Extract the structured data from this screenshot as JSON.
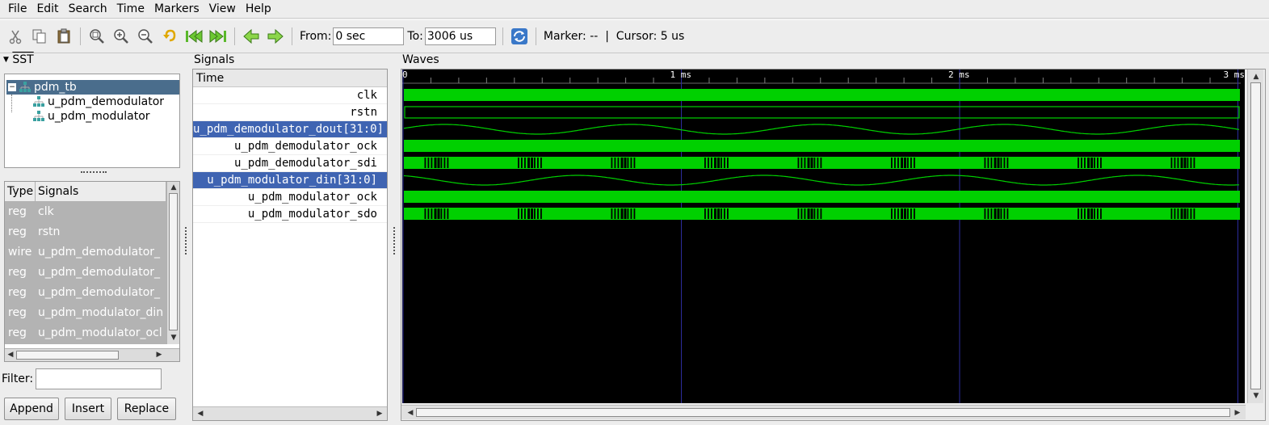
{
  "menu": [
    "File",
    "Edit",
    "Search",
    "Time",
    "Markers",
    "View",
    "Help"
  ],
  "toolbar": {
    "icons": [
      "cut-icon",
      "copy-icon",
      "paste-icon",
      "zoom-fit-icon",
      "zoom-in-icon",
      "zoom-out-icon",
      "undo-zoom-icon",
      "go-to-start-icon",
      "go-to-end-icon",
      "prev-edge-icon",
      "next-edge-icon"
    ],
    "from_label": "From:",
    "from_value": "0 sec",
    "to_label": "To:",
    "to_value": "3006 us",
    "reload_icon": "reload-icon",
    "marker_text": "Marker: --  |  Cursor: 5 us"
  },
  "sst": {
    "title": "SST",
    "tree": {
      "root": "pdm_tb",
      "children": [
        "u_pdm_demodulator",
        "u_pdm_modulator"
      ]
    },
    "list": {
      "col_type": "Type",
      "col_signals": "Signals",
      "rows": [
        {
          "type": "reg",
          "name": "clk"
        },
        {
          "type": "reg",
          "name": "rstn"
        },
        {
          "type": "wire",
          "name": "u_pdm_demodulator_"
        },
        {
          "type": "reg",
          "name": "u_pdm_demodulator_"
        },
        {
          "type": "reg",
          "name": "u_pdm_demodulator_"
        },
        {
          "type": "reg",
          "name": "u_pdm_modulator_din"
        },
        {
          "type": "reg",
          "name": "u_pdm_modulator_ocl"
        }
      ]
    },
    "filter_label": "Filter:",
    "filter_value": "",
    "buttons": {
      "append": "Append",
      "insert": "Insert",
      "replace": "Replace"
    }
  },
  "signals": {
    "title": "Signals",
    "header": "Time",
    "rows": [
      {
        "name": "clk",
        "selected": false
      },
      {
        "name": "rstn",
        "selected": false
      },
      {
        "name": "u_pdm_demodulator_dout[31:0]",
        "selected": true
      },
      {
        "name": "u_pdm_demodulator_ock",
        "selected": false
      },
      {
        "name": "u_pdm_demodulator_sdi",
        "selected": false
      },
      {
        "name": "u_pdm_modulator_din[31:0]",
        "selected": true
      },
      {
        "name": "u_pdm_modulator_ock",
        "selected": false
      },
      {
        "name": "u_pdm_modulator_sdo",
        "selected": false
      }
    ]
  },
  "waves": {
    "title": "Waves",
    "ticks": [
      "0",
      "1 ms",
      "2 ms",
      "3 ms"
    ],
    "wave_color": "#00d000",
    "grid_color": "#2c2c9c",
    "selected_color": "#3f64b2"
  }
}
